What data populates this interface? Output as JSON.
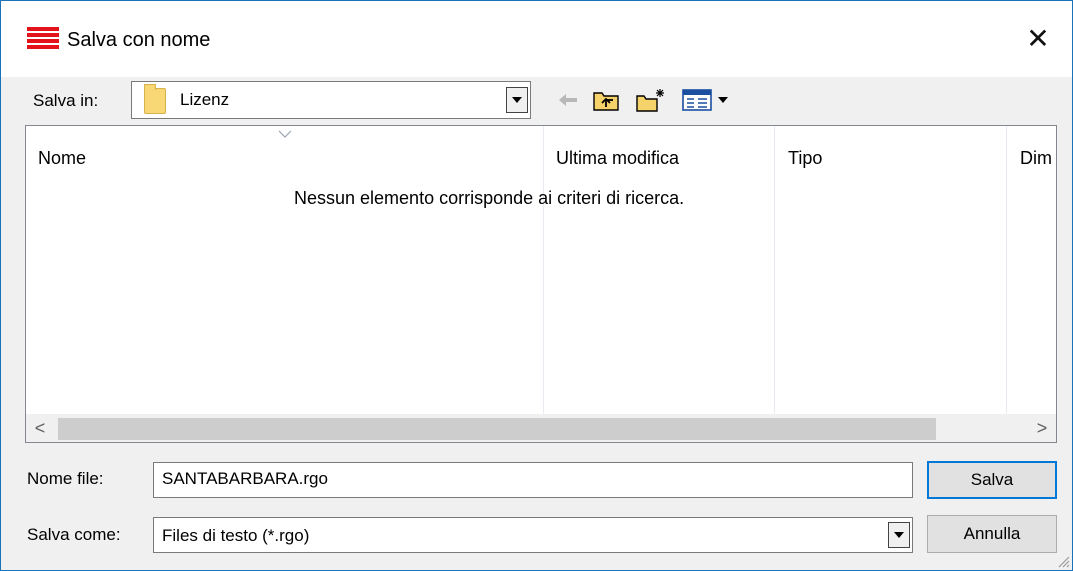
{
  "window": {
    "title": "Salva con nome",
    "close_glyph": "✕",
    "accent_color": "#1a73b8",
    "app_icon_color": "#e3121b"
  },
  "toolbar": {
    "save_in_label": "Salva in:",
    "save_in_value": "Lizenz",
    "icons": [
      "back-arrow-icon",
      "up-folder-icon",
      "new-folder-icon",
      "view-menu-icon"
    ]
  },
  "filelist": {
    "columns": [
      "Nome",
      "Ultima modifica",
      "Tipo",
      "Dim"
    ],
    "empty_message": "Nessun elemento corrisponde ai criteri di ricerca.",
    "scroll_left": "<",
    "scroll_right": ">"
  },
  "filename": {
    "label": "Nome file:",
    "value": "SANTABARBARA.rgo"
  },
  "filetype": {
    "label": "Salva come:",
    "value": "Files di testo (*.rgo)"
  },
  "buttons": {
    "save": "Salva",
    "cancel": "Annulla"
  }
}
